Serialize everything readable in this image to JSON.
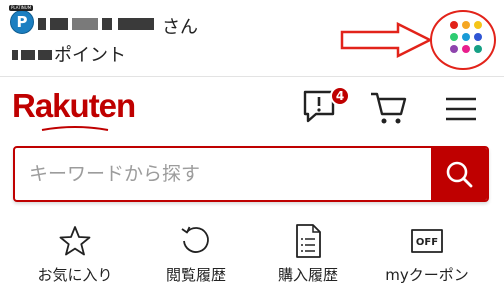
{
  "user": {
    "badge_letter": "P",
    "badge_caption": "PLATINUM",
    "name_suffix": "さん",
    "points_label": "ポイント"
  },
  "header": {
    "logo_text": "Rakuten",
    "notification_count": "4"
  },
  "search": {
    "placeholder": "キーワードから探す"
  },
  "quick_links": [
    {
      "label": "お気に入り",
      "icon": "star-icon"
    },
    {
      "label": "閲覧履歴",
      "icon": "history-icon"
    },
    {
      "label": "購入履歴",
      "icon": "receipt-icon"
    },
    {
      "label": "myクーポン",
      "icon": "coupon-icon",
      "icon_text": "OFF"
    }
  ],
  "colors": {
    "brand_red": "#bf0000",
    "annotation_red": "#e2231a",
    "app_dots": [
      "#e2231a",
      "#f5a623",
      "#f5c518",
      "#2ecc71",
      "#1a9bd7",
      "#2f55d4",
      "#8e44ad",
      "#e91e8c",
      "#16a085"
    ]
  }
}
